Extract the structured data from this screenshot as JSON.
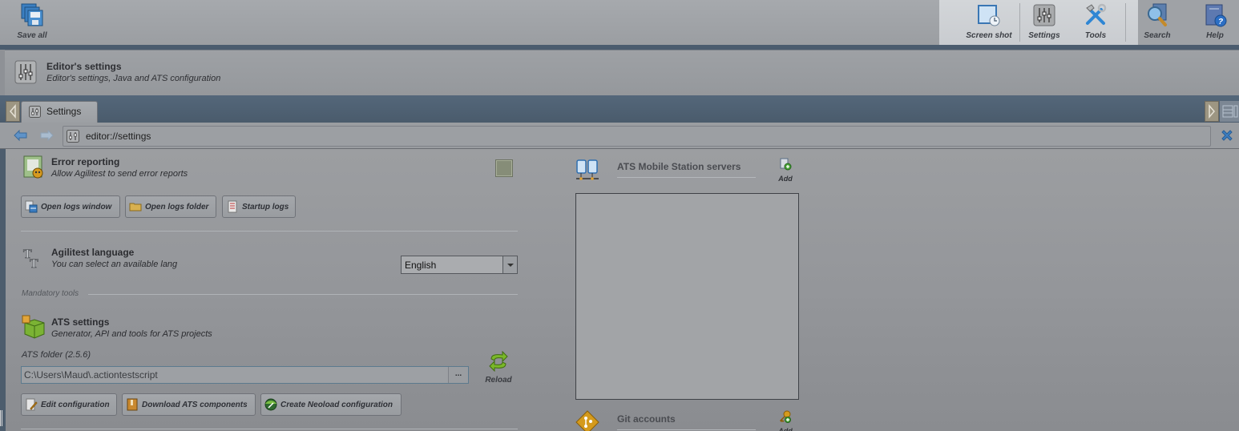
{
  "toolbar": {
    "save_all": "Save all",
    "screenshot": "Screen shot",
    "settings": "Settings",
    "tools": "Tools",
    "search": "Search",
    "help": "Help"
  },
  "header": {
    "title": "Editor's settings",
    "subtitle": "Editor's settings, Java and ATS configuration"
  },
  "tabs": [
    {
      "label": "Settings",
      "active": true
    }
  ],
  "address": {
    "url": "editor://settings"
  },
  "error_reporting": {
    "title": "Error reporting",
    "subtitle": "Allow Agilitest to send error reports",
    "checked": false,
    "buttons": {
      "open_logs_window": "Open logs window",
      "open_logs_folder": "Open logs folder",
      "startup_logs": "Startup logs"
    }
  },
  "language": {
    "title": "Agilitest language",
    "subtitle": "You can select an available lang",
    "selected": "English"
  },
  "mandatory_tools_label": "Mandatory tools",
  "ats_settings": {
    "title": "ATS settings",
    "subtitle": "Generator, API and tools for ATS projects",
    "folder_label": "ATS folder (2.5.6)",
    "folder_value": "C:\\Users\\Maud\\.actiontestscript",
    "browse_label": "...",
    "reload_label": "Reload",
    "buttons": {
      "edit_configuration": "Edit configuration",
      "download_components": "Download ATS components",
      "create_neoload": "Create Neoload configuration"
    }
  },
  "mobile_servers": {
    "title": "ATS Mobile Station servers",
    "add_label": "Add",
    "items": []
  },
  "git_accounts": {
    "title": "Git accounts",
    "add_label": "Add"
  }
}
